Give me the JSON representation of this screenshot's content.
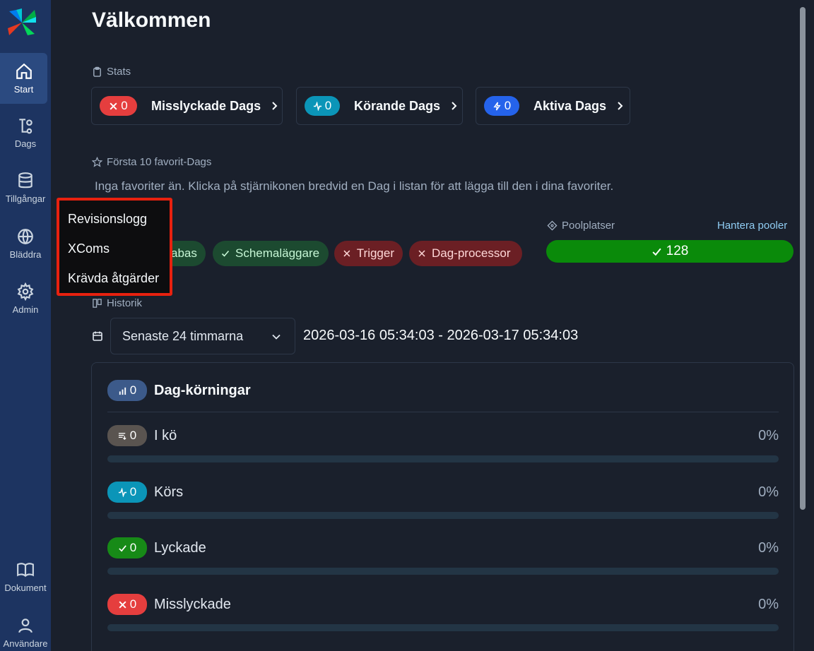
{
  "sidebar": {
    "items": [
      {
        "label": "Start"
      },
      {
        "label": "Dags"
      },
      {
        "label": "Tillgångar"
      },
      {
        "label": "Bläddra"
      },
      {
        "label": "Admin"
      },
      {
        "label": "Dokument"
      },
      {
        "label": "Användare"
      }
    ]
  },
  "header": {
    "title": "Välkommen"
  },
  "stats": {
    "label": "Stats",
    "cards": [
      {
        "count": "0",
        "label": "Misslyckade Dags",
        "color": "#e53e3e"
      },
      {
        "count": "0",
        "label": "Körande Dags",
        "color": "#0b95b8"
      },
      {
        "count": "0",
        "label": "Aktiva Dags",
        "color": "#2563eb"
      }
    ]
  },
  "favorites": {
    "label": "Första 10 favorit-Dags",
    "empty_text": "Inga favoriter än. Klicka på stjärnikonen bredvid en Dag i listan för att lägga till den i dina favoriter."
  },
  "health": {
    "items": [
      {
        "label": "abas",
        "status": "ok"
      },
      {
        "label": "Schemaläggare",
        "status": "ok"
      },
      {
        "label": "Trigger",
        "status": "error"
      },
      {
        "label": "Dag-processor",
        "status": "error"
      }
    ]
  },
  "pool": {
    "label": "Poolplatser",
    "link": "Hantera pooler",
    "value": "128"
  },
  "history": {
    "label": "Historik",
    "range_select": "Senaste 24 timmarna",
    "range_text": "2026-03-16 05:34:03 - 2026-03-17 05:34:03"
  },
  "runs": {
    "title": "Dag-körningar",
    "total": "0",
    "rows": [
      {
        "label": "I kö",
        "count": "0",
        "pct": "0%",
        "fraction": 0,
        "color": "#5a5450"
      },
      {
        "label": "Körs",
        "count": "0",
        "pct": "0%",
        "fraction": 0,
        "color": "#0b95b8"
      },
      {
        "label": "Lyckade",
        "count": "0",
        "pct": "0%",
        "fraction": 0,
        "color": "#178a17"
      },
      {
        "label": "Misslyckade",
        "count": "0",
        "pct": "0%",
        "fraction": 0,
        "color": "#e53e3e"
      }
    ]
  },
  "menu": {
    "items": [
      "Revisionslogg",
      "XComs",
      "Krävda åtgärder"
    ]
  }
}
